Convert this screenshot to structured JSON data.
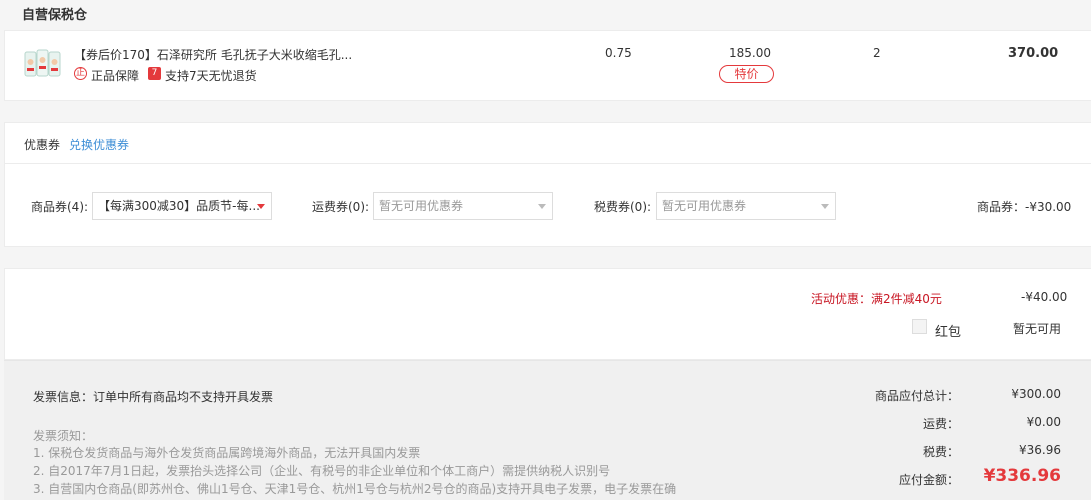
{
  "warehouse": {
    "title": "自营保税仓"
  },
  "product": {
    "name": "【券后价170】石泽研究所 毛孔抚子大米收缩毛孔...",
    "guarantee_icon": "正",
    "guarantee_label": "正品保障",
    "return_icon": "7",
    "return_label": "支持7天无忧退货",
    "discount": "0.75",
    "price": "185.00",
    "tag": "特价",
    "quantity": "2",
    "total": "370.00"
  },
  "coupons": {
    "title": "优惠券",
    "exchange_link": "兑换优惠券",
    "goods_label": "商品券(4):",
    "goods_selected": "【每满300减30】品质节-每...",
    "shipping_label": "运费券(0):",
    "shipping_selected": "暂无可用优惠券",
    "tax_label": "税费券(0):",
    "tax_selected": "暂无可用优惠券",
    "summary": "商品券：-¥30.00"
  },
  "promotion": {
    "label": "活动优惠：满2件减40元",
    "amount": "-¥40.00",
    "redpacket_label": "红包",
    "redpacket_status": "暂无可用"
  },
  "invoice": {
    "info": "发票信息：订单中所有商品均不支持开具发票",
    "notice_title": "发票须知：",
    "notices": [
      "1. 保税仓发货商品与海外仓发货商品属跨境海外商品，无法开具国内发票",
      "2. 自2017年7月1日起，发票抬头选择公司（企业、有税号的非企业单位和个体工商户）需提供纳税人识别号",
      "3. 自营国内仓商品(即苏州仓、佛山1号仓、天津1号仓、杭州1号仓与杭州2号仓的商品)支持开具电子发票，电子发票在确"
    ]
  },
  "summary": {
    "goods_label": "商品应付总计：",
    "goods_value": "¥300.00",
    "shipping_label": "运费：",
    "shipping_value": "¥0.00",
    "tax_label": "税费：",
    "tax_value": "¥36.96",
    "payable_label": "应付金额：",
    "payable_value": "¥336.96"
  },
  "colors": {
    "accent": "#e4393c",
    "link": "#3d8ed6",
    "promo": "#c81623"
  }
}
